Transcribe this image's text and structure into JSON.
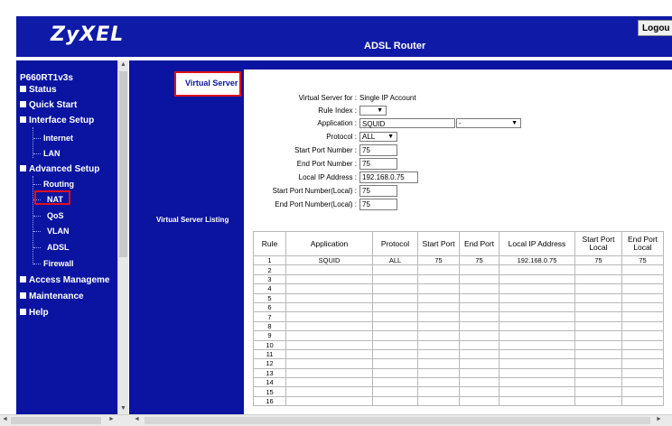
{
  "header": {
    "logo": "ZyXEL",
    "product": "ADSL Router",
    "logout_label": "Logou"
  },
  "sidebar": {
    "model": "P660RT1v3s",
    "menu": [
      {
        "label": "Status"
      },
      {
        "label": "Quick Start"
      },
      {
        "label": "Interface Setup"
      },
      {
        "label": "Advanced Setup"
      },
      {
        "label": "Access Manageme"
      },
      {
        "label": "Maintenance"
      },
      {
        "label": "Help"
      }
    ],
    "interface_sub": [
      "Internet",
      "LAN"
    ],
    "advanced_sub": [
      "Routing",
      "NAT",
      "QoS",
      "VLAN",
      "ADSL",
      "Firewall"
    ]
  },
  "sections": {
    "virtual_server": "Virtual Server",
    "virtual_server_listing": "Virtual Server Listing"
  },
  "form": {
    "for_label": "Virtual Server for :",
    "for_value": "Single IP Account",
    "rule_index_label": "Rule Index :",
    "rule_index_value": "",
    "application_label": "Application :",
    "application_value": "SQUID",
    "application_select": "-",
    "protocol_label": "Protocol :",
    "protocol_value": "ALL",
    "start_port_label": "Start Port Number :",
    "start_port_value": "75",
    "end_port_label": "End Port Number :",
    "end_port_value": "75",
    "local_ip_label": "Local IP Address :",
    "local_ip_value": "192.168.0.75",
    "start_port_local_label": "Start Port Number(Local) :",
    "start_port_local_value": "75",
    "end_port_local_label": "End Port Number(Local) :",
    "end_port_local_value": "75"
  },
  "table": {
    "headers": [
      "Rule",
      "Application",
      "Protocol",
      "Start Port",
      "End Port",
      "Local IP Address",
      "Start Port Local",
      "End Port Local"
    ],
    "rows": [
      [
        "1",
        "SQUID",
        "ALL",
        "75",
        "75",
        "192.168.0.75",
        "75",
        "75"
      ],
      [
        "2",
        "",
        "",
        "",
        "",
        "",
        "",
        ""
      ],
      [
        "3",
        "",
        "",
        "",
        "",
        "",
        "",
        ""
      ],
      [
        "4",
        "",
        "",
        "",
        "",
        "",
        "",
        ""
      ],
      [
        "5",
        "",
        "",
        "",
        "",
        "",
        "",
        ""
      ],
      [
        "6",
        "",
        "",
        "",
        "",
        "",
        "",
        ""
      ],
      [
        "7",
        "",
        "",
        "",
        "",
        "",
        "",
        ""
      ],
      [
        "8",
        "",
        "",
        "",
        "",
        "",
        "",
        ""
      ],
      [
        "9",
        "",
        "",
        "",
        "",
        "",
        "",
        ""
      ],
      [
        "10",
        "",
        "",
        "",
        "",
        "",
        "",
        ""
      ],
      [
        "11",
        "",
        "",
        "",
        "",
        "",
        "",
        ""
      ],
      [
        "12",
        "",
        "",
        "",
        "",
        "",
        "",
        ""
      ],
      [
        "13",
        "",
        "",
        "",
        "",
        "",
        "",
        ""
      ],
      [
        "14",
        "",
        "",
        "",
        "",
        "",
        "",
        ""
      ],
      [
        "15",
        "",
        "",
        "",
        "",
        "",
        "",
        ""
      ],
      [
        "16",
        "",
        "",
        "",
        "",
        "",
        "",
        ""
      ]
    ]
  },
  "colors": {
    "brand_blue": "#0a14a0",
    "highlight_red": "#e0101a"
  },
  "icons": {
    "scroll_up": "▲",
    "scroll_down": "▼",
    "scroll_left": "◄",
    "scroll_right": "►",
    "select_arrow": "▼"
  }
}
